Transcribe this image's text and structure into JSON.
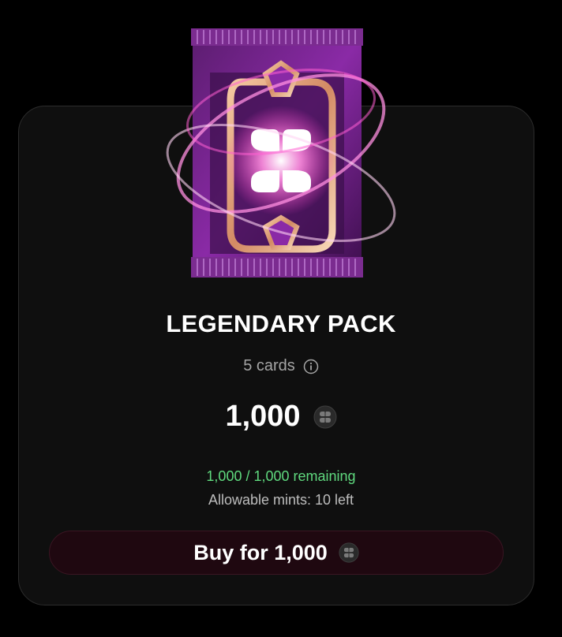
{
  "pack": {
    "title": "LEGENDARY PACK",
    "cards_count": "5 cards",
    "price": "1,000",
    "remaining": "1,000 / 1,000 remaining",
    "mints": "Allowable mints: 10 left",
    "buy_label": "Buy for 1,000",
    "image_icon": "legendary-pack-art",
    "currency_icon": "coin-icon",
    "info_icon": "info-icon"
  },
  "colors": {
    "background": "#000000",
    "card_background": "#0f0f0f",
    "remaining_text": "#5fd97e",
    "button_background": "#1f0810",
    "pack_glow": "#ff3fc8"
  }
}
